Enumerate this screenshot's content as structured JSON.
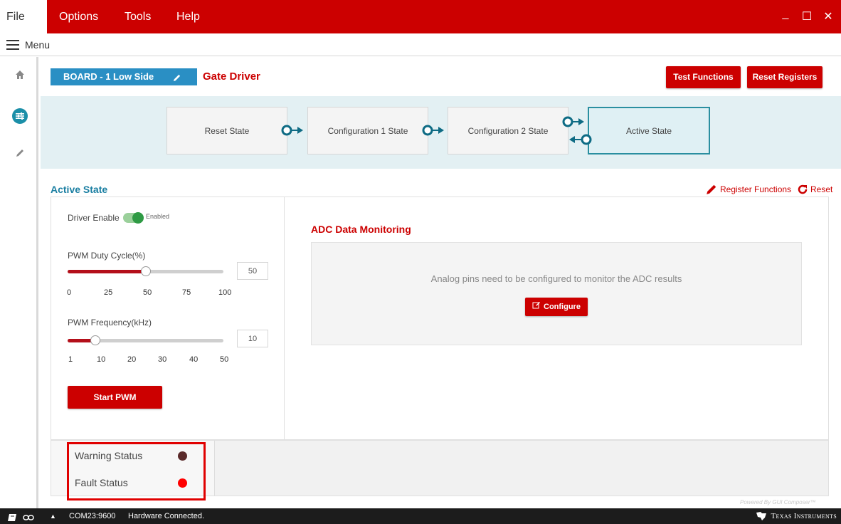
{
  "menubar": {
    "file": "File",
    "options": "Options",
    "tools": "Tools",
    "help": "Help",
    "minimize": "_",
    "maximize": "☐",
    "close": "✕",
    "bg_color": "#cc0000"
  },
  "menurow": {
    "label": "Menu"
  },
  "leftnav": {
    "items": [
      "home-icon",
      "sliders-icon",
      "pencil-icon"
    ]
  },
  "header": {
    "board_badge": "BOARD - 1 Low Side",
    "title": "Gate Driver",
    "test_functions": "Test Functions",
    "reset_registers": "Reset Registers"
  },
  "states": [
    {
      "label": "Reset State",
      "active": false
    },
    {
      "label": "Configuration 1 State",
      "active": false
    },
    {
      "label": "Configuration 2 State",
      "active": false
    },
    {
      "label": "Active State",
      "active": true
    }
  ],
  "section": {
    "title": "Active State",
    "register_functions": "Register Functions",
    "reset": "Reset"
  },
  "controls": {
    "driver_enable_label": "Driver Enable",
    "driver_enable_state": "Enabled",
    "driver_enabled": true,
    "duty_label": "PWM Duty Cycle(%)",
    "duty_value": "50",
    "duty_fraction": 0.5,
    "duty_ticks": [
      "0",
      "25",
      "50",
      "75",
      "100"
    ],
    "freq_label": "PWM Frequency(kHz)",
    "freq_value": "10",
    "freq_fraction": 0.18,
    "freq_ticks": [
      "1",
      "10",
      "20",
      "30",
      "40",
      "50"
    ],
    "start_pwm": "Start PWM"
  },
  "adc": {
    "title": "ADC Data Monitoring",
    "message": "Analog pins need to be configured to monitor the ADC results",
    "configure": "Configure"
  },
  "status": {
    "warning_label": "Warning Status",
    "warning_color": "#5a2a2a",
    "fault_label": "Fault Status",
    "fault_color": "#ff0000"
  },
  "footer": {
    "powered_by": "Powered By GUI Composer™",
    "port": "COM23:9600",
    "connection": "Hardware Connected.",
    "brand": "Texas Instruments"
  }
}
